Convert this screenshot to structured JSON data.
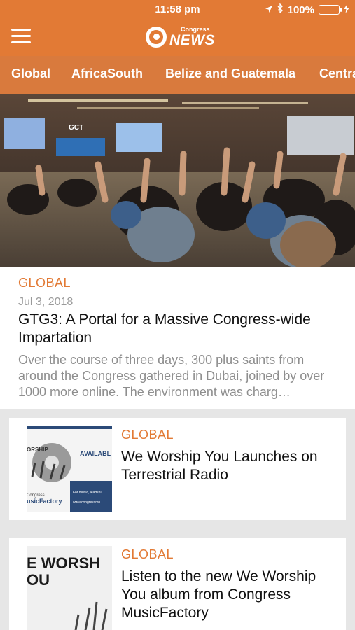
{
  "status": {
    "time": "11:58 pm",
    "battery": "100%"
  },
  "app": {
    "logo_small": "Congress",
    "logo_big": "NEWS"
  },
  "tabs": [
    "Global",
    "AfricaSouth",
    "Belize and Guatemala",
    "Centra"
  ],
  "featured": {
    "category": "GLOBAL",
    "date": "Jul 3, 2018",
    "title": "GTG3: A Portal for a Massive Congress-wide Impartation",
    "excerpt": "Over the course of three days, 300 plus saints from around the Congress gathered in Dubai, joined by over 1000 more online. The environment was charg…",
    "image_screen_text": "GCT"
  },
  "articles": [
    {
      "category": "GLOBAL",
      "title": "We Worship You Launches on Terrestrial Radio",
      "thumb": {
        "line1": "ORSHIP",
        "line2": "AVAILABL",
        "line3": "Congress",
        "line4": "usicFactory",
        "line5": "For music, leadshi",
        "line6": "www.congressmu"
      }
    },
    {
      "category": "GLOBAL",
      "title": "Listen to the new We Worship You album from Congress MusicFactory",
      "thumb": {
        "line1": "E WORSH",
        "line2": "OU"
      }
    }
  ],
  "colors": {
    "brand": "#e27a35",
    "tabbar": "#d97a3d",
    "muted": "#8e8e8e"
  }
}
